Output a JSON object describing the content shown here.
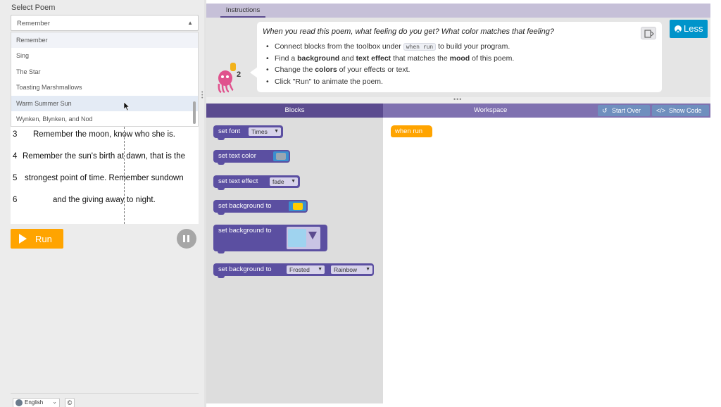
{
  "left_panel": {
    "select_label": "Select Poem",
    "selected_poem": "Remember",
    "dropdown_options": [
      "Remember",
      "Sing",
      "The Star",
      "Toasting Marshmallows",
      "Warm Summer Sun",
      "Wynken, Blynken, and Nod"
    ],
    "hovered_option": "Warm Summer Sun",
    "poem_lines": [
      {
        "num": "3",
        "text": "Remember the moon, know who she is."
      },
      {
        "num": "4",
        "text": "Remember the sun's birth at dawn, that is the"
      },
      {
        "num": "5",
        "text": "strongest point of time. Remember sundown"
      },
      {
        "num": "6",
        "text": "and the giving away to night."
      }
    ],
    "run_label": "Run",
    "language": "English",
    "copyright_glyph": "©"
  },
  "instructions": {
    "tab_label": "Instructions",
    "question": "When you read this poem, what feeling do you get? What color matches that feeling?",
    "steps": [
      {
        "parts": [
          {
            "t": "Connect blocks from the toolbox under "
          },
          {
            "t": "when run",
            "code": true
          },
          {
            "t": " to build your program."
          }
        ]
      },
      {
        "parts": [
          {
            "t": "Find a "
          },
          {
            "t": "background",
            "bold": true
          },
          {
            "t": " and "
          },
          {
            "t": "text effect",
            "bold": true
          },
          {
            "t": " that matches the "
          },
          {
            "t": "mood",
            "bold": true
          },
          {
            "t": " of this poem."
          }
        ]
      },
      {
        "parts": [
          {
            "t": "Change the "
          },
          {
            "t": "colors",
            "bold": true
          },
          {
            "t": " of your effects or text."
          }
        ]
      },
      {
        "parts": [
          {
            "t": "Click \"Run\" to animate the poem."
          }
        ]
      }
    ],
    "less_label": "Less",
    "hint_count": "2"
  },
  "blocks_panel": {
    "header": "Blocks",
    "blocks": [
      {
        "label": "set font",
        "field": "Times"
      },
      {
        "label": "set text color",
        "color": "#9aa6b2"
      },
      {
        "label": "set text effect",
        "field": "fade"
      },
      {
        "label": "set background to",
        "color": "#ffcc00"
      },
      {
        "label": "set background to",
        "image": "frosted-image"
      },
      {
        "label": "set background to",
        "field": "Frosted",
        "field2": "Rainbow"
      }
    ]
  },
  "workspace": {
    "header": "Workspace",
    "start_over_label": "Start Over",
    "show_code_label": "Show Code",
    "start_block": "when run"
  },
  "icons": {
    "dropdown_caret": "▲",
    "select_arrow": "▼",
    "start_over_glyph": "↺",
    "show_code_glyph": "</>",
    "copyright": "©"
  },
  "colors": {
    "run_orange": "#ffa400",
    "block_purple": "#5b4fa1",
    "header_purple": "#5b4b8f",
    "workspace_header": "#7f71b0",
    "less_blue": "#0094ca"
  }
}
